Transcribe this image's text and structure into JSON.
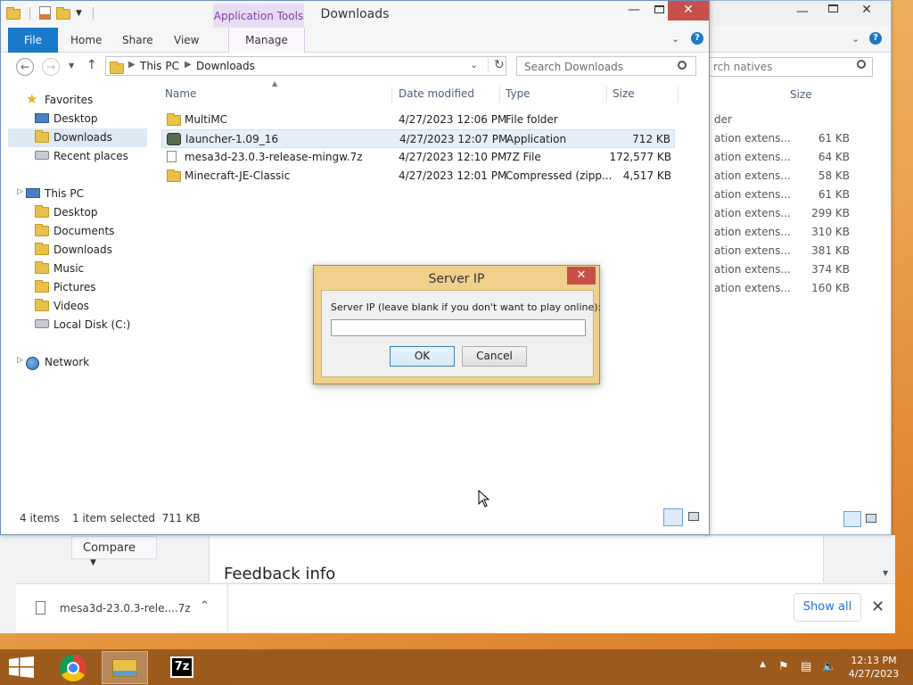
{
  "back_window": {
    "search_placeholder": "rch natives",
    "size_header": "Size",
    "rows": [
      {
        "type": "der",
        "size": ""
      },
      {
        "type": "ation extens...",
        "size": "61 KB"
      },
      {
        "type": "ation extens...",
        "size": "64 KB"
      },
      {
        "type": "ation extens...",
        "size": "58 KB"
      },
      {
        "type": "ation extens...",
        "size": "61 KB"
      },
      {
        "type": "ation extens...",
        "size": "299 KB"
      },
      {
        "type": "ation extens...",
        "size": "310 KB"
      },
      {
        "type": "ation extens...",
        "size": "381 KB"
      },
      {
        "type": "ation extens...",
        "size": "374 KB"
      },
      {
        "type": "ation extens...",
        "size": "160 KB"
      }
    ]
  },
  "explorer": {
    "title": "Downloads",
    "context_tab": "Application Tools",
    "ribbon_tabs": [
      "File",
      "Home",
      "Share",
      "View",
      "Manage"
    ],
    "breadcrumb": [
      "This PC",
      "Downloads"
    ],
    "search_placeholder": "Search Downloads",
    "nav": {
      "favorites": "Favorites",
      "fav_items": [
        "Desktop",
        "Downloads",
        "Recent places"
      ],
      "this_pc": "This PC",
      "pc_items": [
        "Desktop",
        "Documents",
        "Downloads",
        "Music",
        "Pictures",
        "Videos",
        "Local Disk (C:)"
      ],
      "network": "Network"
    },
    "columns": {
      "name": "Name",
      "date": "Date modified",
      "type": "Type",
      "size": "Size"
    },
    "files": [
      {
        "name": "MultiMC",
        "date": "4/27/2023 12:06 PM",
        "type": "File folder",
        "size": "",
        "icon": "folder-icon"
      },
      {
        "name": "launcher-1.09_16",
        "date": "4/27/2023 12:07 PM",
        "type": "Application",
        "size": "712 KB",
        "icon": "application-icon"
      },
      {
        "name": "mesa3d-23.0.3-release-mingw.7z",
        "date": "4/27/2023 12:10 PM",
        "type": "7Z File",
        "size": "172,577 KB",
        "icon": "file-icon"
      },
      {
        "name": "Minecraft-JE-Classic",
        "date": "4/27/2023 12:01 PM",
        "type": "Compressed (zipp...",
        "size": "4,517 KB",
        "icon": "zip-folder-icon"
      }
    ],
    "status": {
      "count": "4 items",
      "selection": "1 item selected  711 KB"
    }
  },
  "chrome": {
    "compare_label": "Compare",
    "feedback_title": "Feedback info",
    "download_item": "mesa3d-23.0.3-rele....7z",
    "show_all": "Show all"
  },
  "dialog": {
    "title": "Server IP",
    "prompt": "Server IP (leave blank if you don't want to play online):",
    "input_value": "",
    "ok": "OK",
    "cancel": "Cancel"
  },
  "taskbar": {
    "time": "12:13 PM",
    "date": "4/27/2023",
    "apps": [
      "chrome-icon",
      "file-explorer-icon",
      "7zip-icon"
    ]
  }
}
